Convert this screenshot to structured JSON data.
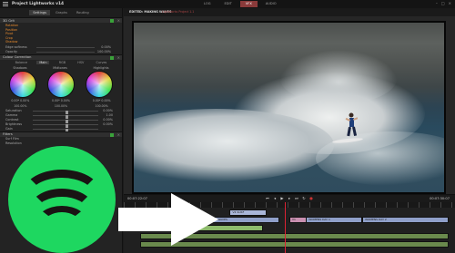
{
  "app": {
    "title": "Project Lightworks v14",
    "top_tabs": [
      {
        "label": "LOG",
        "active": false
      },
      {
        "label": "EDIT",
        "active": false
      },
      {
        "label": "VFX",
        "active": true
      },
      {
        "label": "AUDIO",
        "active": false
      }
    ]
  },
  "left_panel": {
    "tabs": [
      {
        "label": "Settings",
        "active": true
      },
      {
        "label": "Graphs",
        "active": false
      },
      {
        "label": "Routing",
        "active": false
      }
    ],
    "fx_section": {
      "title": "3D Grit",
      "items": [
        "Rotation",
        "Position",
        "Pivot",
        "Crop",
        "Shadow"
      ],
      "params": [
        {
          "label": "Edge softness",
          "value": "0.00%"
        },
        {
          "label": "Opacity",
          "value": "100.00%"
        }
      ]
    },
    "colour_section": {
      "title": "Colour Correction",
      "subtabs": [
        {
          "label": "Balance",
          "active": false
        },
        {
          "label": "Main",
          "active": true
        },
        {
          "label": "RGB",
          "active": false
        },
        {
          "label": "HSV",
          "active": false
        },
        {
          "label": "Curves",
          "active": false
        }
      ],
      "wheels": [
        {
          "label": "Shadows",
          "v1": "0.00*",
          "v2": "0.00%",
          "level": "100.00%"
        },
        {
          "label": "Midtones",
          "v1": "0.00*",
          "v2": "0.00%",
          "level": "100.00%"
        },
        {
          "label": "Highlights",
          "v1": "0.00*",
          "v2": "0.00%",
          "level": "100.00%"
        }
      ],
      "sliders": [
        {
          "label": "Saturation",
          "value": "0.00%",
          "level": 0.5
        },
        {
          "label": "Gamma",
          "value": "1.00",
          "level": 0.5
        },
        {
          "label": "Contrast",
          "value": "0.00%",
          "level": 0.5
        },
        {
          "label": "Brightness",
          "value": "0.00%",
          "level": 0.5
        },
        {
          "label": "Gain",
          "value": "",
          "level": 0.5
        }
      ]
    },
    "filters_section": {
      "title": "Filters",
      "items": [
        "Surf Film",
        "Resolution"
      ]
    },
    "bottom_label": "Resolution"
  },
  "viewer": {
    "title": "EDITED: MAKING WAVES",
    "subtitle": "Lightworks Project 1.1",
    "timecode_left": "00:07:22:07",
    "timecode_right": "00:07:30:07",
    "transport_icons": [
      "skip-back-icon",
      "step-back-icon",
      "play-icon",
      "step-forward-icon",
      "skip-forward-icon",
      "loop-icon",
      "record-icon"
    ]
  },
  "timeline": {
    "clips": [
      {
        "label": "V4 SURF",
        "track": 0,
        "start": 0.32,
        "end": 0.43,
        "kind": "v2"
      },
      {
        "label": "MAKING WAVES",
        "track": 1,
        "start": 0.24,
        "end": 0.47,
        "kind": "v"
      },
      {
        "label": "V1",
        "track": 1,
        "start": 0.5,
        "end": 0.66,
        "kind": "pink"
      },
      {
        "label": "WOMENS DAY 1",
        "track": 1,
        "start": 0.55,
        "end": 0.72,
        "kind": "v"
      },
      {
        "label": "WOMENS DAY 2",
        "track": 1,
        "start": 0.72,
        "end": 0.98,
        "kind": "v"
      },
      {
        "label": "SURF 5",
        "track": 2,
        "start": 0.05,
        "end": 0.2,
        "kind": "a"
      },
      {
        "label": "SURF 6",
        "track": 2,
        "start": 0.2,
        "end": 0.42,
        "kind": "a"
      },
      {
        "label": "",
        "track": 3,
        "start": 0.05,
        "end": 0.98,
        "kind": "aud"
      },
      {
        "label": "",
        "track": 4,
        "start": 0.05,
        "end": 0.98,
        "kind": "aud"
      }
    ]
  }
}
